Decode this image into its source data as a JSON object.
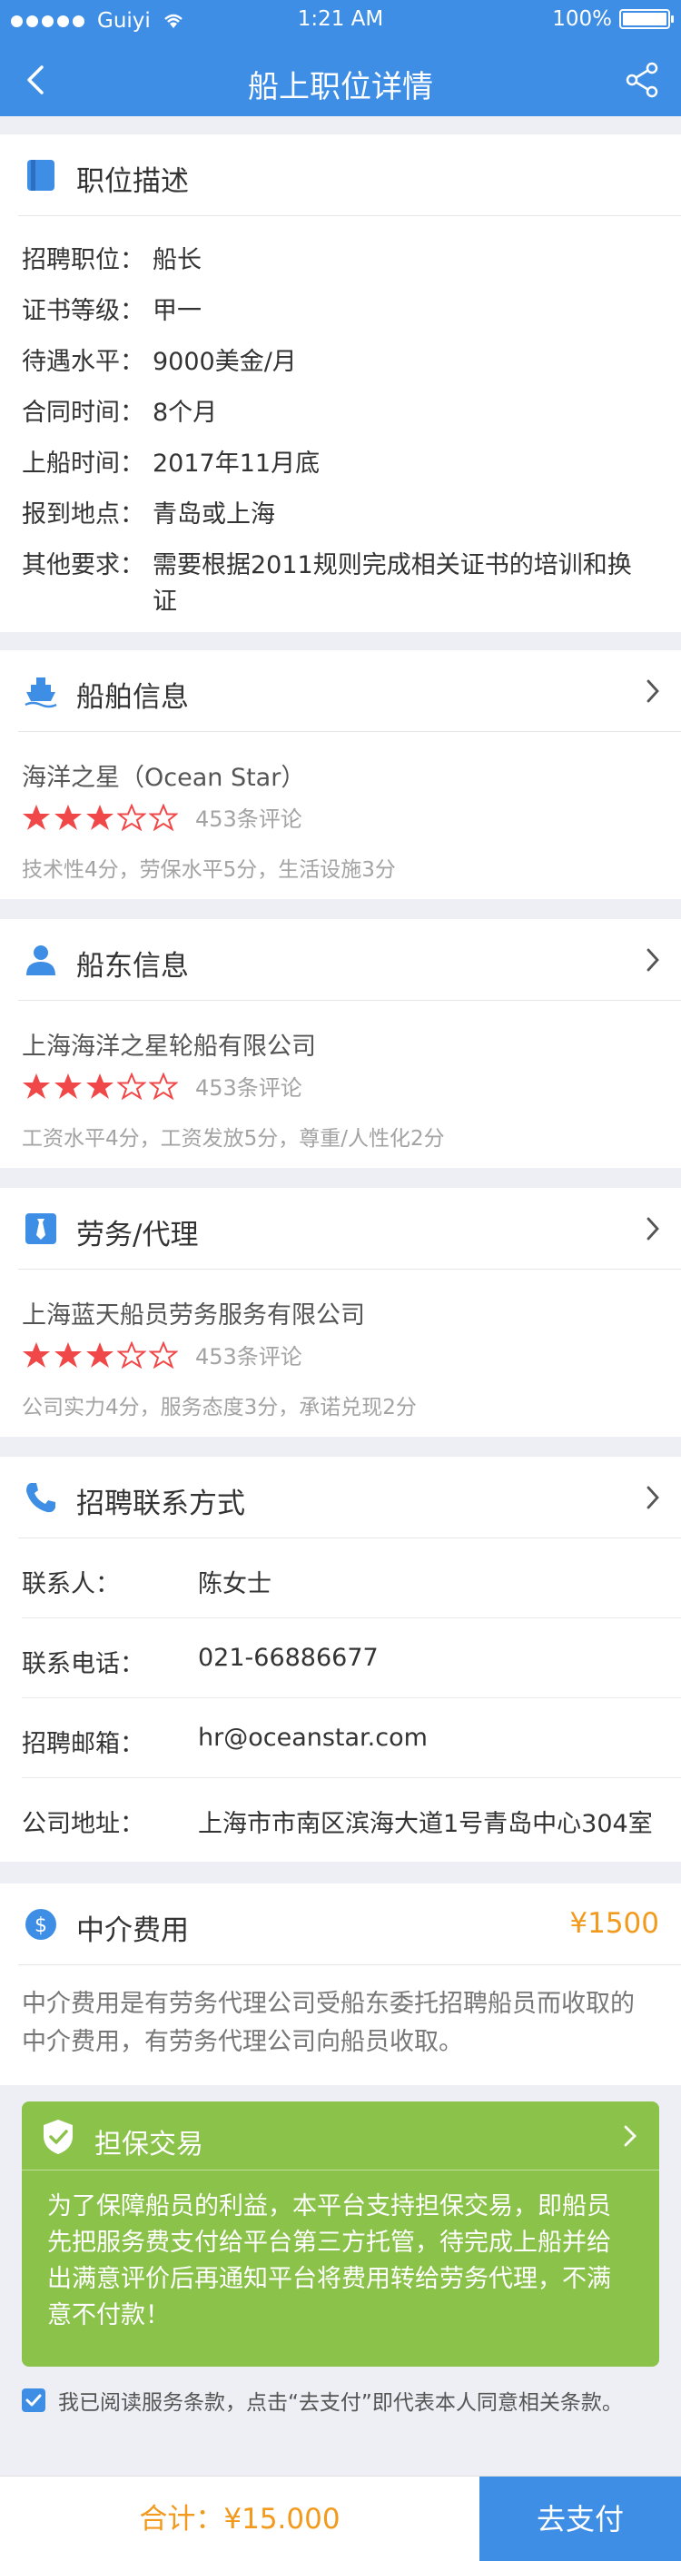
{
  "status_bar": {
    "carrier": "Guiyi",
    "time": "1:21 AM",
    "battery": "100%"
  },
  "nav": {
    "title": "船上职位详情"
  },
  "job": {
    "title": "职位描述",
    "rows": [
      {
        "label": "招聘职位：",
        "value": "船长"
      },
      {
        "label": "证书等级：",
        "value": "甲一"
      },
      {
        "label": "待遇水平：",
        "value": "9000美金/月"
      },
      {
        "label": "合同时间：",
        "value": "8个月"
      },
      {
        "label": "上船时间：",
        "value": "2017年11月底"
      },
      {
        "label": "报到地点：",
        "value": "青岛或上海"
      },
      {
        "label": "其他要求：",
        "value_line1": "需要根据2011规则完成相关证书的培训和换",
        "value_line2": "证"
      }
    ]
  },
  "ship": {
    "title": "船舶信息",
    "name": "海洋之星（Ocean Star）",
    "rating": 3,
    "reviews": "453条评论",
    "scores": "技术性4分，劳保水平5分，生活设施3分"
  },
  "owner": {
    "title": "船东信息",
    "name": "上海海洋之星轮船有限公司",
    "rating": 3,
    "reviews": "453条评论",
    "scores": "工资水平4分，工资发放5分，尊重/人性化2分"
  },
  "agency": {
    "title": "劳务/代理",
    "name": "上海蓝天船员劳务服务有限公司",
    "rating": 3,
    "reviews": "453条评论",
    "scores": "公司实力4分，服务态度3分，承诺兑现2分"
  },
  "contact": {
    "title": "招聘联系方式",
    "rows": [
      {
        "label": "联系人：",
        "value": "陈女士"
      },
      {
        "label": "联系电话：",
        "value": "021-66886677"
      },
      {
        "label": "招聘邮箱：",
        "value": "hr@oceanstar.com"
      },
      {
        "label": "公司地址：",
        "value": "上海市市南区滨海大道1号青岛中心304室"
      }
    ]
  },
  "fee": {
    "title": "中介费用",
    "amount": "¥1500",
    "desc_line1": "中介费用是有劳务代理公司受船东委托招聘船员而收取的",
    "desc_line2": "中介费用，有劳务代理公司向船员收取。"
  },
  "guarantee": {
    "title": "担保交易",
    "line1": "为了保障船员的利益，本平台支持担保交易，即船员",
    "line2": "先把服务费支付给平台第三方托管，待完成上船并给",
    "line3": "出满意评价后再通知平台将费用转给劳务代理，不满",
    "line4": "意不付款！"
  },
  "agreement": "我已阅读服务条款，点击“去支付”即代表本人同意相关条款。",
  "footer": {
    "total": "合计：¥15.000",
    "pay": "去支付"
  },
  "colors": {
    "primary": "#3f8ee5",
    "accent": "#f19a1d",
    "guarantee_bg": "#8bc34a",
    "star": "#f04848"
  },
  "icons": [
    "back-arrow-icon",
    "share-icon",
    "document-icon",
    "ship-icon",
    "person-icon",
    "tie-icon",
    "phone-icon",
    "dollar-icon",
    "shield-check-icon",
    "chevron-right-icon",
    "star-icon",
    "checkbox-icon"
  ]
}
